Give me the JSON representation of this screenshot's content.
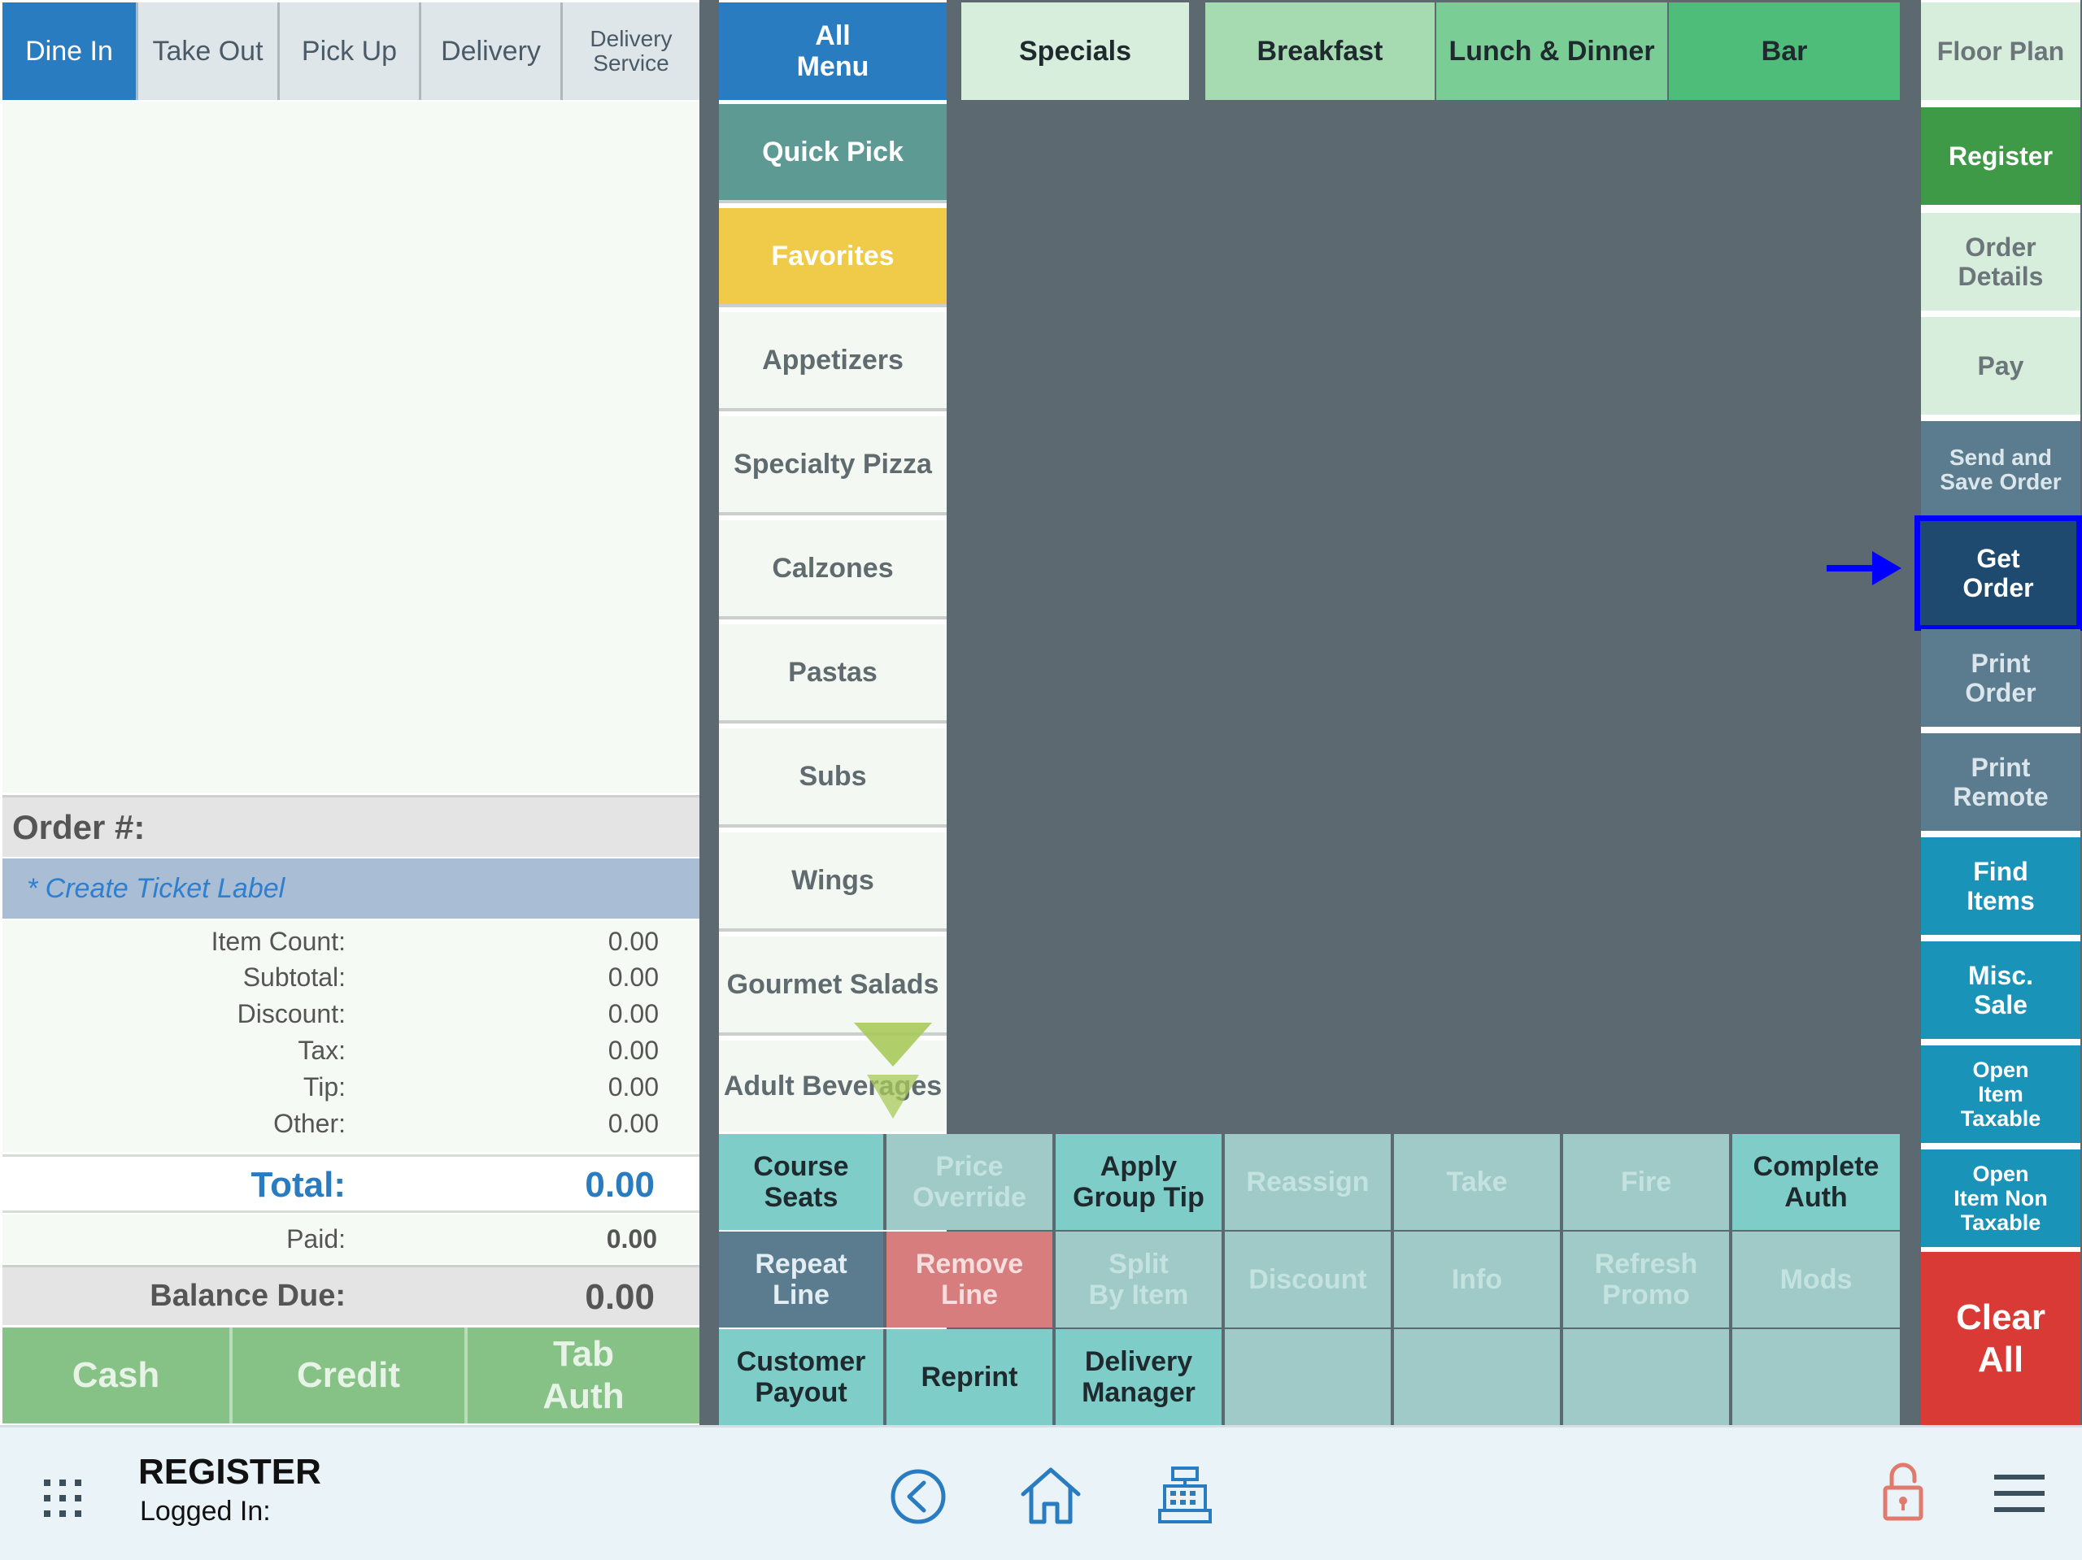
{
  "order_types": [
    {
      "label": "Dine In",
      "active": true
    },
    {
      "label": "Take Out"
    },
    {
      "label": "Pick Up"
    },
    {
      "label": "Delivery"
    },
    {
      "label": "Delivery\nService"
    }
  ],
  "order": {
    "order_number_label": "Order #:",
    "ticket_label": "* Create Ticket Label",
    "totals": [
      {
        "label": "Item Count:",
        "value": "0.00"
      },
      {
        "label": "Subtotal:",
        "value": "0.00"
      },
      {
        "label": "Discount:",
        "value": "0.00"
      },
      {
        "label": "Tax:",
        "value": "0.00"
      },
      {
        "label": "Tip:",
        "value": "0.00"
      },
      {
        "label": "Other:",
        "value": "0.00"
      }
    ],
    "total_label": "Total:",
    "total_value": "0.00",
    "paid_label": "Paid:",
    "paid_value": "0.00",
    "balance_label": "Balance Due:",
    "balance_value": "0.00"
  },
  "payment_buttons": [
    "Cash",
    "Credit",
    "Tab\nAuth"
  ],
  "menu_tabs": [
    "All\nMenu",
    "Specials",
    "Breakfast",
    "Lunch & Dinner",
    "Bar"
  ],
  "categories": [
    "Quick Pick",
    "Favorites",
    "Appetizers",
    "Specialty Pizza",
    "Calzones",
    "Pastas",
    "Subs",
    "Wings",
    "Gourmet Salads",
    "Adult Beverages"
  ],
  "right_buttons": [
    "Floor Plan",
    "Register",
    "Order\nDetails",
    "Pay",
    "Send and\nSave Order",
    "Get\nOrder",
    "Print\nOrder",
    "Print\nRemote",
    "Find\nItems",
    "Misc.\nSale",
    "Open\nItem\nTaxable",
    "Open\nItem Non\nTaxable",
    "Clear\nAll"
  ],
  "actions": {
    "row1": [
      "Course\nSeats",
      "Price\nOverride",
      "Apply\nGroup Tip",
      "Reassign",
      "Take",
      "Fire",
      "Complete\nAuth"
    ],
    "row2": [
      "Repeat\nLine",
      "Remove\nLine",
      "Split\nBy Item",
      "Discount",
      "Info",
      "Refresh\nPromo",
      "Mods"
    ],
    "row3": [
      "Customer\nPayout",
      "Reprint",
      "Delivery\nManager",
      "",
      "",
      "",
      ""
    ]
  },
  "footer": {
    "title": "REGISTER",
    "logged_in": "Logged In:"
  },
  "colors": {
    "primary_blue": "#2a7cc1",
    "highlight_outline": "#0000ff",
    "clear_red": "#d93a35",
    "register_green": "#3e9a47"
  }
}
